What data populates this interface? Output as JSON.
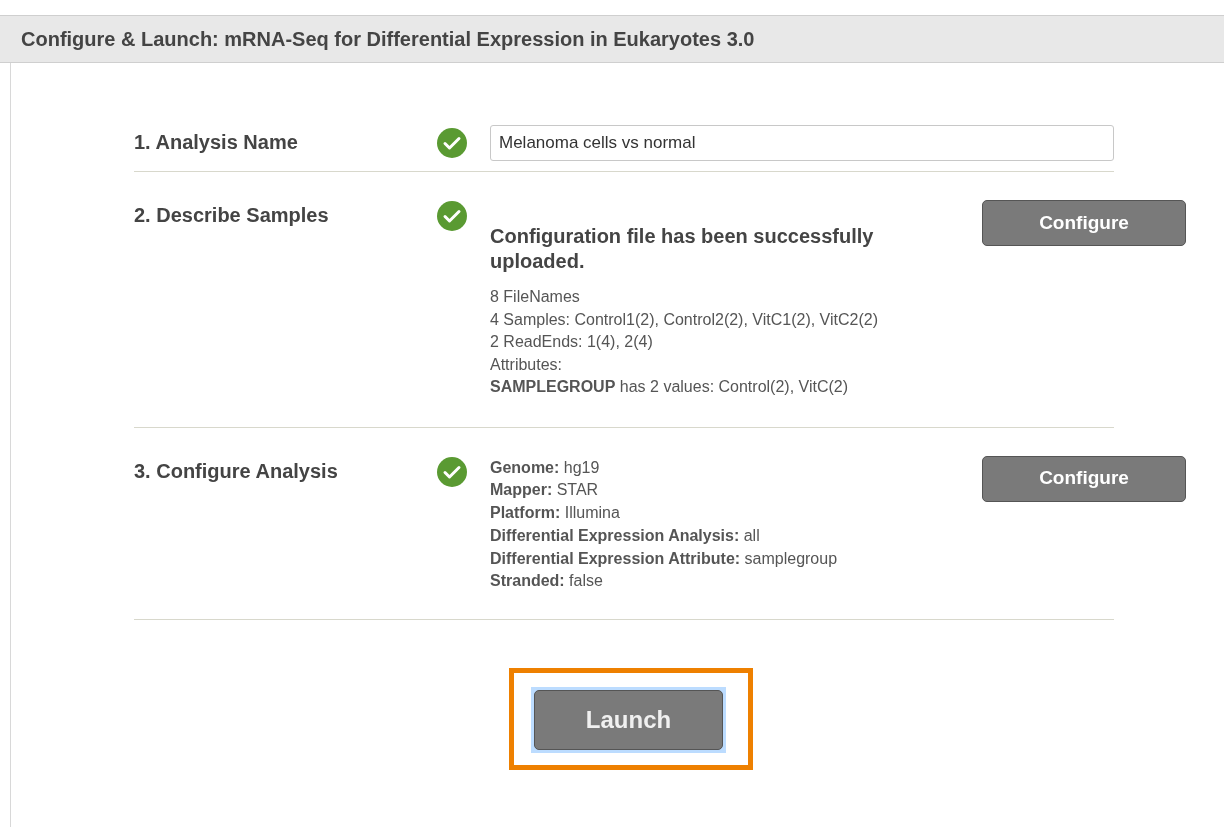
{
  "header": {
    "title": "Configure & Launch: mRNA-Seq for Differential Expression in Eukaryotes 3.0"
  },
  "steps": [
    {
      "kind": "field",
      "label": "1. Analysis Name",
      "complete": true,
      "value": "Melanoma cells vs normal"
    },
    {
      "kind": "samples",
      "label": "2. Describe Samples",
      "complete": true,
      "message": "Configuration file has been successfully uploaded.",
      "lines": [
        "8 FileNames",
        "4 Samples: Control1(2), Control2(2), VitC1(2), VitC2(2)",
        "2 ReadEnds: 1(4), 2(4)",
        "Attributes:",
        "**SAMPLEGROUP** has 2 values: Control(2), VitC(2)"
      ],
      "button": "Configure"
    },
    {
      "kind": "settings",
      "label": "3. Configure Analysis",
      "complete": true,
      "lines": [
        "**Genome:** hg19",
        "**Mapper:** STAR",
        "**Platform:** Illumina",
        "**Differential Expression Analysis:** all",
        "**Differential Expression Attribute:** samplegroup",
        "**Stranded:** false"
      ],
      "button": "Configure"
    }
  ],
  "launch": {
    "label": "Launch",
    "highlighted": true,
    "focused": true
  }
}
